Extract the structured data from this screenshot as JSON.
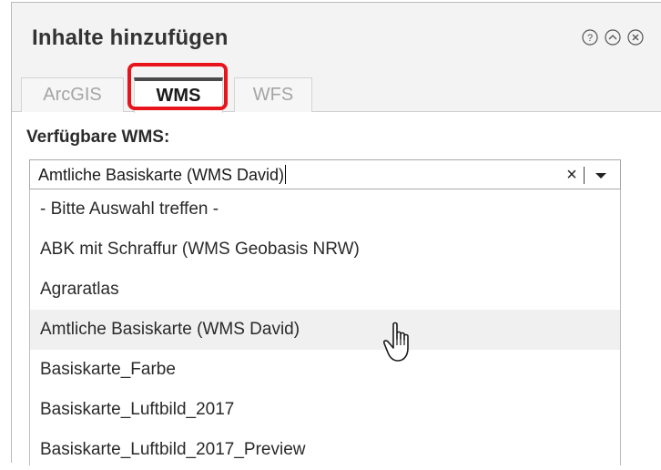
{
  "panel": {
    "title": "Inhalte hinzufügen",
    "window_buttons": [
      {
        "name": "help-icon",
        "glyph": "?"
      },
      {
        "name": "collapse-icon",
        "glyph": "chevron-up"
      },
      {
        "name": "close-icon",
        "glyph": "x"
      }
    ]
  },
  "tabs": [
    {
      "label": "ArcGIS",
      "active": false
    },
    {
      "label": "WMS",
      "active": true
    },
    {
      "label": "WFS",
      "active": false
    }
  ],
  "highlight": {
    "target": "WMS tab",
    "color": "#e8141c"
  },
  "form": {
    "label": "Verfügbare WMS:",
    "combo": {
      "value": "Amtliche Basiskarte (WMS David)",
      "clear_glyph": "×"
    }
  },
  "list": {
    "items": [
      {
        "label": "- Bitte Auswahl treffen -",
        "hovered": false
      },
      {
        "label": "ABK mit Schraffur (WMS Geobasis NRW)",
        "hovered": false
      },
      {
        "label": "Agraratlas",
        "hovered": false
      },
      {
        "label": "Amtliche Basiskarte (WMS David)",
        "hovered": true
      },
      {
        "label": "Basiskarte_Farbe",
        "hovered": false
      },
      {
        "label": "Basiskarte_Luftbild_2017",
        "hovered": false
      },
      {
        "label": "Basiskarte_Luftbild_2017_Preview",
        "hovered": false
      }
    ]
  },
  "colors": {
    "accent_highlight": "#e8141c",
    "title_bar": "#f3f3f3",
    "hover_row": "#f0f0f0"
  }
}
